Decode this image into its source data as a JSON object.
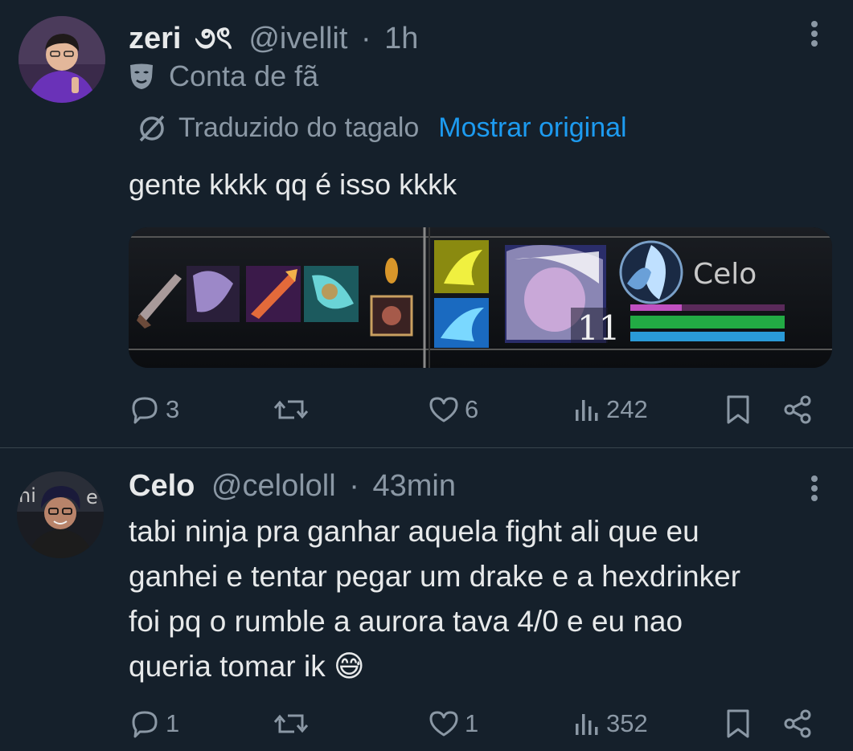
{
  "tweets": [
    {
      "display_name": "zeri",
      "name_emoji": "૭ৎ",
      "handle": "@ivellit",
      "separator": "·",
      "time": "1h",
      "account_label": "Conta de fã",
      "translation_note": "Traduzido do tagalo",
      "show_original": "Mostrar original",
      "text": "gente kkkk qq é isso kkkk",
      "media": {
        "player_name": "Celo",
        "level": "11"
      },
      "counts": {
        "replies": "3",
        "retweets": "",
        "likes": "6",
        "views": "242"
      }
    },
    {
      "display_name": "Celo",
      "handle": "@celololl",
      "separator": "·",
      "time": "43min",
      "text_lines": [
        "tabi ninja pra ganhar aquela fight ali que eu",
        "ganhei e tentar pegar um drake e a hexdrinker",
        "foi pq o rumble a aurora tava 4/0 e eu nao",
        "queria tomar ik"
      ],
      "emoji": "😅",
      "counts": {
        "replies": "1",
        "retweets": "",
        "likes": "1",
        "views": "352"
      }
    }
  ],
  "colors": {
    "background": "#15202b",
    "text": "#e7e9ea",
    "muted": "#8b98a5",
    "link": "#1d9bf0",
    "divider": "#38444d"
  }
}
